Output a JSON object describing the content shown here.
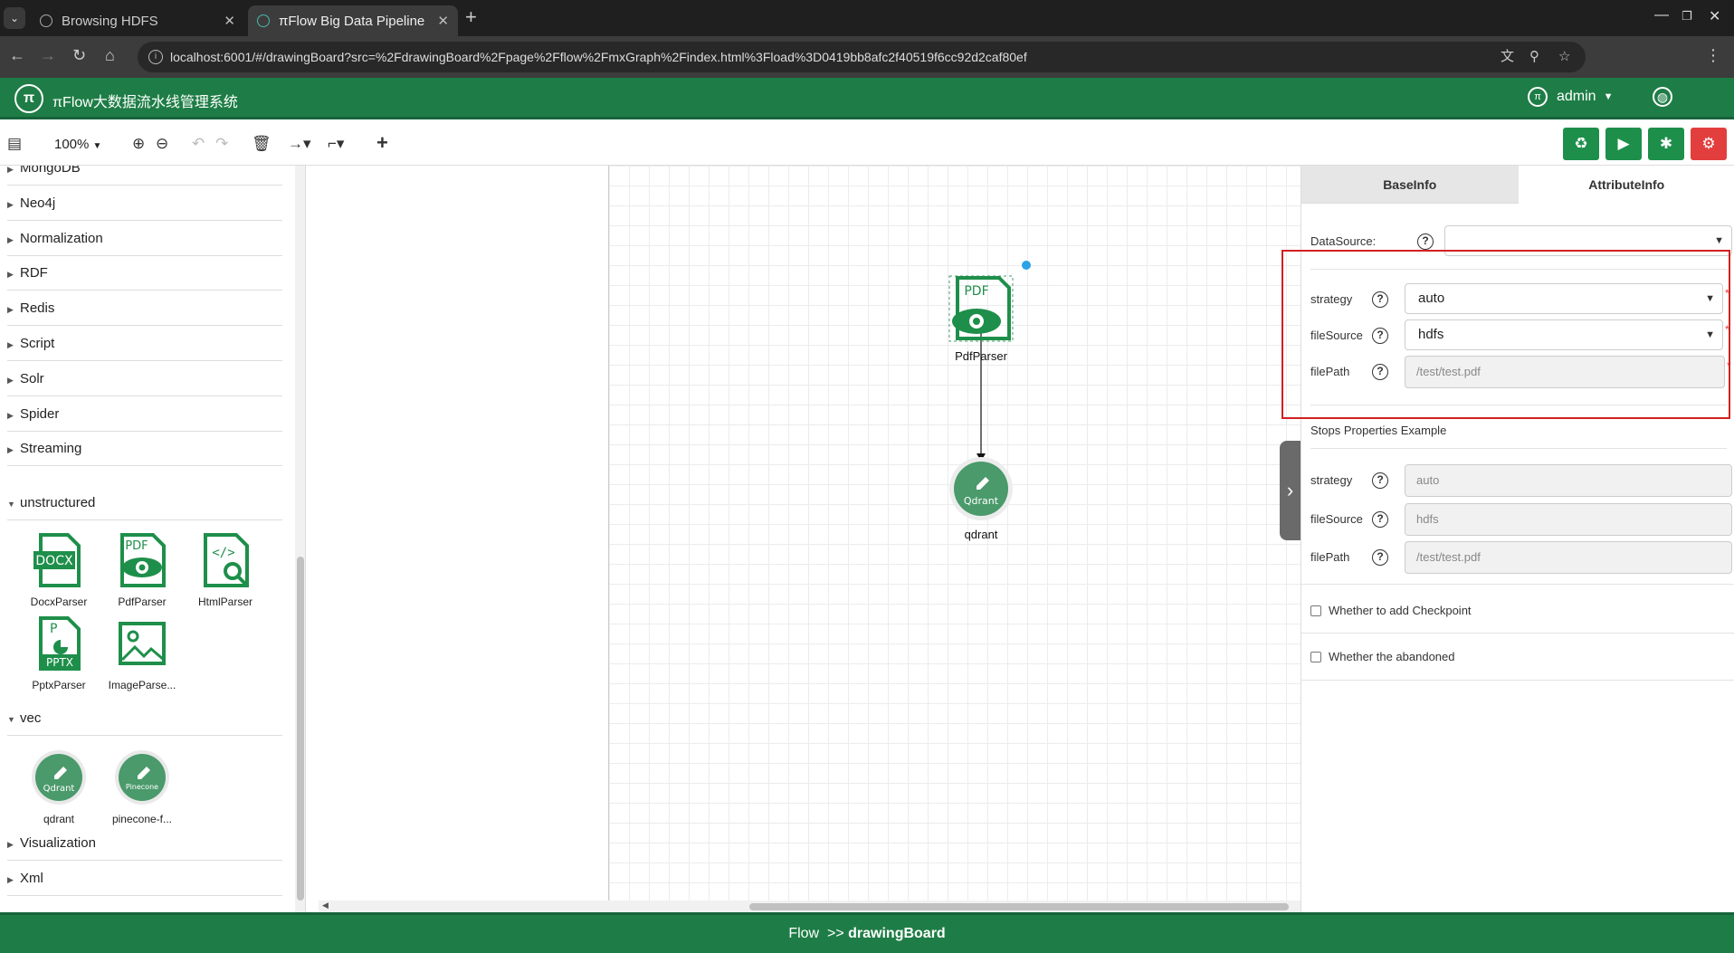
{
  "browser": {
    "tabs": [
      {
        "title": "Browsing HDFS"
      },
      {
        "title": "πFlow Big Data Pipeline"
      }
    ],
    "new_tab": "+",
    "url": "localhost:6001/#/drawingBoard?src=%2FdrawingBoard%2Fpage%2Fflow%2FmxGraph%2Findex.html%3Fload%3D0419bb8afc2f40519f6cc92d2caf80ef"
  },
  "app": {
    "title": "πFlow大数据流水线管理系统",
    "logo_text": "π",
    "user": "admin"
  },
  "toolbar": {
    "zoom": "100%",
    "colors": {
      "green": "#1e8f4a",
      "red": "#e33e3e"
    }
  },
  "palette": {
    "categories_top": [
      "MongoDB",
      "Neo4j",
      "Normalization",
      "RDF",
      "Redis",
      "Script",
      "Solr",
      "Spider",
      "Streaming"
    ],
    "unstructured": {
      "label": "unstructured",
      "items": [
        "DocxParser",
        "PdfParser",
        "HtmlParser",
        "PptxParser",
        "ImageParse..."
      ]
    },
    "vec": {
      "label": "vec",
      "items": [
        "qdrant",
        "pinecone-f..."
      ],
      "icon_texts": [
        "Qdrant",
        "Pinecone"
      ]
    },
    "categories_bottom": [
      "Visualization",
      "Xml"
    ]
  },
  "canvas": {
    "nodes": [
      {
        "label": "PdfParser",
        "icon_text": "PDF"
      },
      {
        "label": "qdrant",
        "icon_text": "Qdrant"
      }
    ]
  },
  "panel": {
    "tabs": [
      "BaseInfo",
      "AttributeInfo"
    ],
    "datasource_label": "DataSource:",
    "datasource_value": "",
    "fields": [
      {
        "label": "strategy",
        "value": "auto"
      },
      {
        "label": "fileSource",
        "value": "hdfs"
      },
      {
        "label": "filePath",
        "placeholder": "/test/test.pdf"
      }
    ],
    "required_mark": "*",
    "example_title": "Stops Properties Example",
    "example_fields": [
      {
        "label": "strategy",
        "value": "auto"
      },
      {
        "label": "fileSource",
        "value": "hdfs"
      },
      {
        "label": "filePath",
        "value": "/test/test.pdf"
      }
    ],
    "checkpoint_label": "Whether to add Checkpoint",
    "abandoned_label": "Whether the abandoned"
  },
  "footer": {
    "prefix": "Flow  >> ",
    "current": "drawingBoard"
  }
}
